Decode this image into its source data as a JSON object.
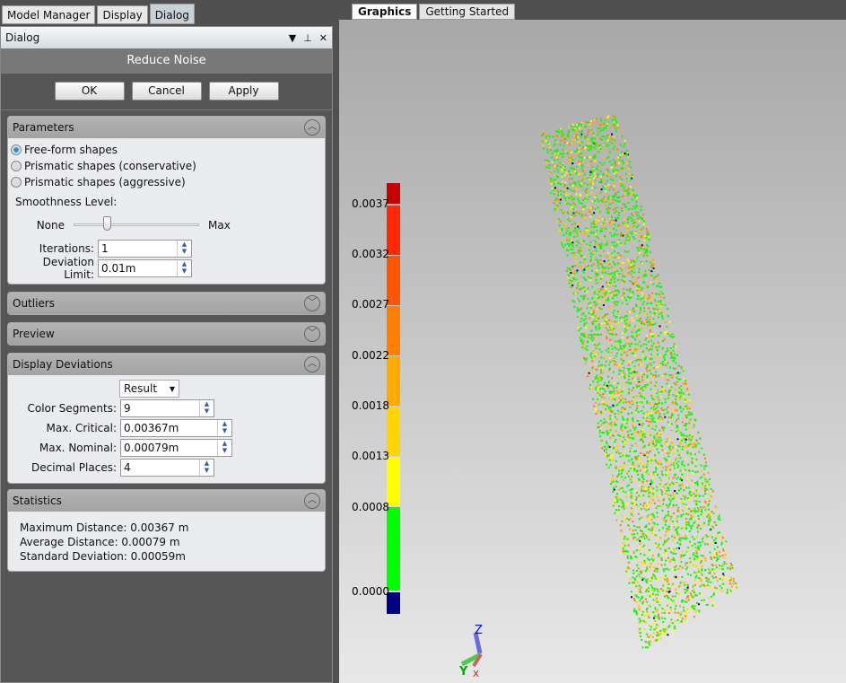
{
  "tabs": [
    "Model Manager",
    "Display",
    "Dialog"
  ],
  "panel": {
    "title": "Dialog",
    "heading": "Reduce Noise",
    "ok": "OK",
    "cancel": "Cancel",
    "apply": "Apply"
  },
  "parameters": {
    "title": "Parameters",
    "options": [
      "Free-form shapes",
      "Prismatic shapes (conservative)",
      "Prismatic shapes (aggressive)"
    ],
    "selected": 0,
    "smoothness_label": "Smoothness Level:",
    "slider_min": "None",
    "slider_max": "Max",
    "slider_value": 0.25,
    "iterations_label": "Iterations:",
    "iterations": "1",
    "deviation_label": "Deviation Limit:",
    "deviation": "0.01m"
  },
  "outliers": {
    "title": "Outliers"
  },
  "preview": {
    "title": "Preview"
  },
  "display": {
    "title": "Display Deviations",
    "mode": "Result",
    "segments_label": "Color Segments:",
    "segments": "9",
    "maxcrit_label": "Max. Critical:",
    "maxcrit": "0.00367m",
    "maxnom_label": "Max. Nominal:",
    "maxnom": "0.00079m",
    "decimal_label": "Decimal Places:",
    "decimal": "4"
  },
  "statistics": {
    "title": "Statistics",
    "lines": [
      "Maximum Distance: 0.00367 m",
      "Average Distance: 0.00079 m",
      "Standard Deviation: 0.00059m"
    ]
  },
  "graphics": {
    "tabs": [
      "Graphics",
      "Getting Started"
    ],
    "legend": {
      "labels": [
        "0.0037",
        "0.0032",
        "0.0027",
        "0.0022",
        "0.0018",
        "0.0013",
        "0.0008",
        "0.0000"
      ],
      "colors": [
        "#c80000",
        "#ff2800",
        "#ff5500",
        "#ff8000",
        "#ffaa00",
        "#ffd400",
        "#ffff00",
        "#00ff00",
        "#000080"
      ]
    },
    "axes": {
      "z": "Z",
      "y": "Y",
      "x": "X"
    }
  }
}
